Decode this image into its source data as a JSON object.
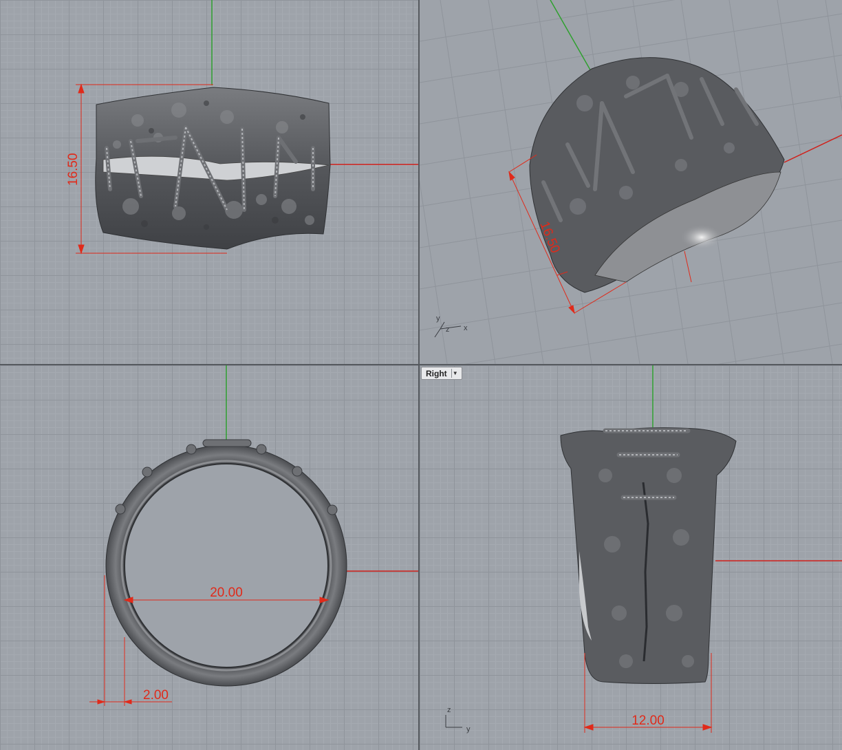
{
  "viewports": {
    "top": {
      "dim_height": "16.50"
    },
    "perspective": {
      "dim_height": "16.50",
      "axis_y": "y",
      "axis_z": "z",
      "axis_x": "x"
    },
    "front": {
      "dim_inner": "20.00",
      "dim_thickness": "2.00"
    },
    "right": {
      "label": "Right",
      "dim_width": "12.00",
      "axis_z": "z",
      "axis_y": "y"
    }
  },
  "colors": {
    "viewport_bg": "#9ea3aa",
    "dimension": "#e02a1a",
    "axis_green": "#2fa02f",
    "axis_red": "#d0201a",
    "metal": "#5d5f63"
  }
}
